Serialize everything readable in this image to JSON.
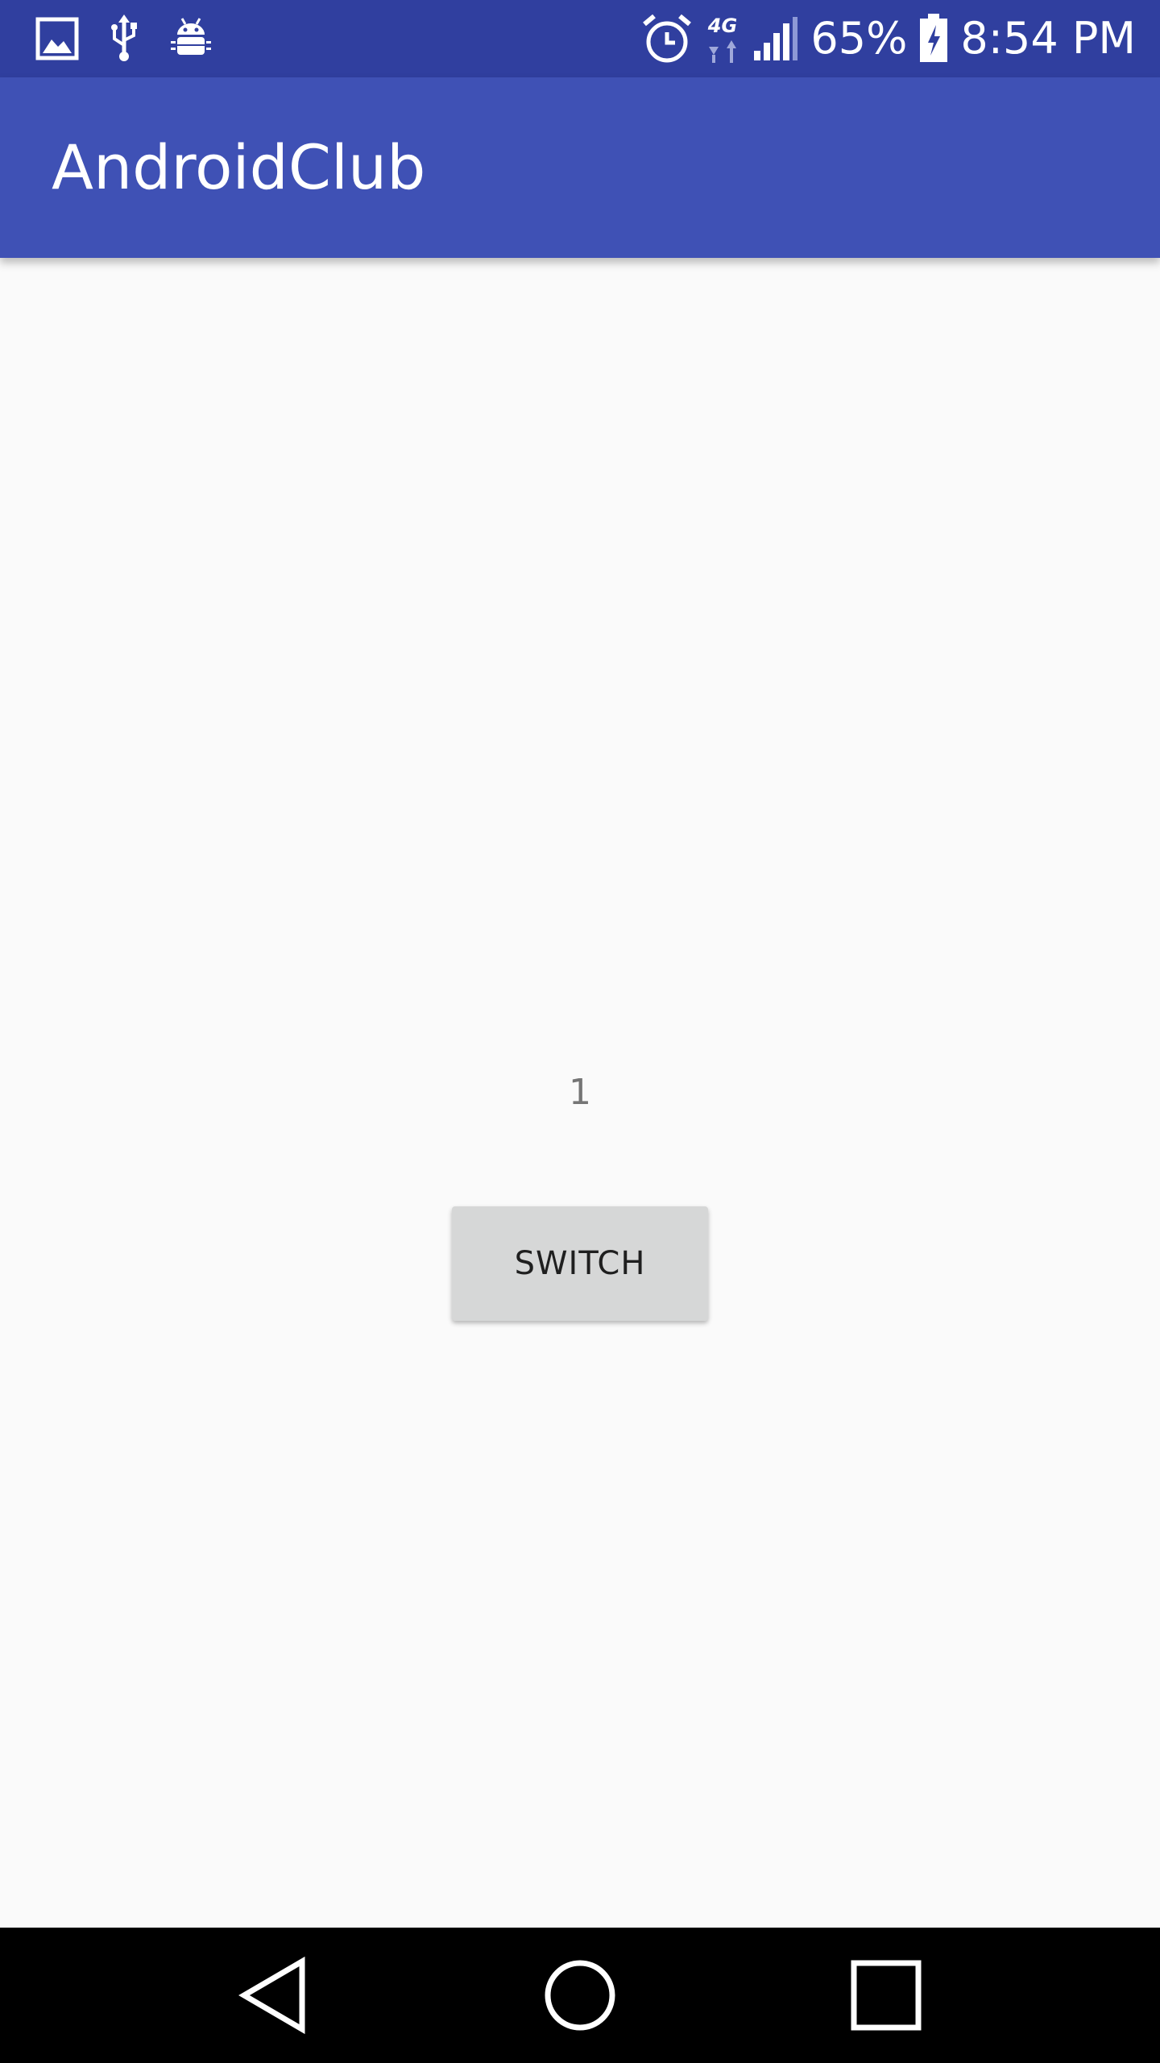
{
  "status_bar": {
    "left_icons": [
      "image-icon",
      "usb-icon",
      "android-debug-icon"
    ],
    "right_icons": [
      "alarm-icon",
      "network-4g-icon",
      "signal-icon",
      "battery-charging-icon"
    ],
    "network_label": "4G",
    "battery_percent": "65%",
    "time": "8:54 PM",
    "background_color": "#303f9f"
  },
  "app_bar": {
    "title": "AndroidClub",
    "background_color": "#3f51b5"
  },
  "main": {
    "counter_value": "1",
    "switch_button_label": "SWITCH"
  },
  "nav_bar": {
    "buttons": [
      "back-icon",
      "home-icon",
      "recents-icon"
    ]
  }
}
